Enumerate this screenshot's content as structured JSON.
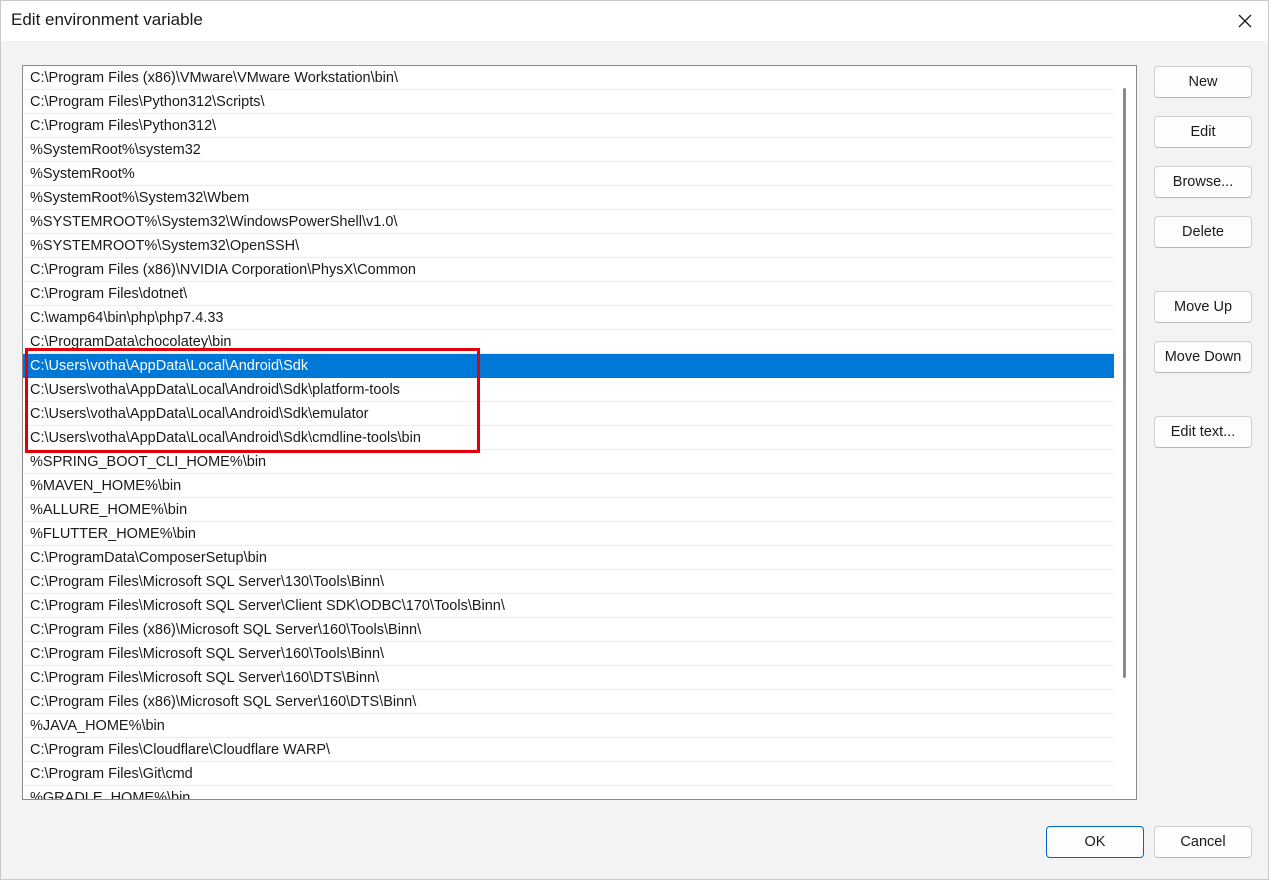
{
  "window": {
    "title": "Edit environment variable",
    "close_icon": "close-icon"
  },
  "paths": [
    "C:\\Program Files (x86)\\VMware\\VMware Workstation\\bin\\",
    "C:\\Program Files\\Python312\\Scripts\\",
    "C:\\Program Files\\Python312\\",
    "%SystemRoot%\\system32",
    "%SystemRoot%",
    "%SystemRoot%\\System32\\Wbem",
    "%SYSTEMROOT%\\System32\\WindowsPowerShell\\v1.0\\",
    "%SYSTEMROOT%\\System32\\OpenSSH\\",
    "C:\\Program Files (x86)\\NVIDIA Corporation\\PhysX\\Common",
    "C:\\Program Files\\dotnet\\",
    "C:\\wamp64\\bin\\php\\php7.4.33",
    "C:\\ProgramData\\chocolatey\\bin",
    "C:\\Users\\votha\\AppData\\Local\\Android\\Sdk",
    "C:\\Users\\votha\\AppData\\Local\\Android\\Sdk\\platform-tools",
    "C:\\Users\\votha\\AppData\\Local\\Android\\Sdk\\emulator",
    "C:\\Users\\votha\\AppData\\Local\\Android\\Sdk\\cmdline-tools\\bin",
    "%SPRING_BOOT_CLI_HOME%\\bin",
    "%MAVEN_HOME%\\bin",
    "%ALLURE_HOME%\\bin",
    "%FLUTTER_HOME%\\bin",
    "C:\\ProgramData\\ComposerSetup\\bin",
    "C:\\Program Files\\Microsoft SQL Server\\130\\Tools\\Binn\\",
    "C:\\Program Files\\Microsoft SQL Server\\Client SDK\\ODBC\\170\\Tools\\Binn\\",
    "C:\\Program Files (x86)\\Microsoft SQL Server\\160\\Tools\\Binn\\",
    "C:\\Program Files\\Microsoft SQL Server\\160\\Tools\\Binn\\",
    "C:\\Program Files\\Microsoft SQL Server\\160\\DTS\\Binn\\",
    "C:\\Program Files (x86)\\Microsoft SQL Server\\160\\DTS\\Binn\\",
    "%JAVA_HOME%\\bin",
    "C:\\Program Files\\Cloudflare\\Cloudflare WARP\\",
    "C:\\Program Files\\Git\\cmd",
    "%GRADLE_HOME%\\bin"
  ],
  "selected_index": 12,
  "colors": {
    "selection": "#0078d7",
    "highlight_box": "#e0000b",
    "primary_border": "#0067c0"
  },
  "buttons": {
    "new": "New",
    "edit": "Edit",
    "browse": "Browse...",
    "delete": "Delete",
    "move_up": "Move Up",
    "move_down": "Move Down",
    "edit_text": "Edit text...",
    "ok": "OK",
    "cancel": "Cancel"
  }
}
